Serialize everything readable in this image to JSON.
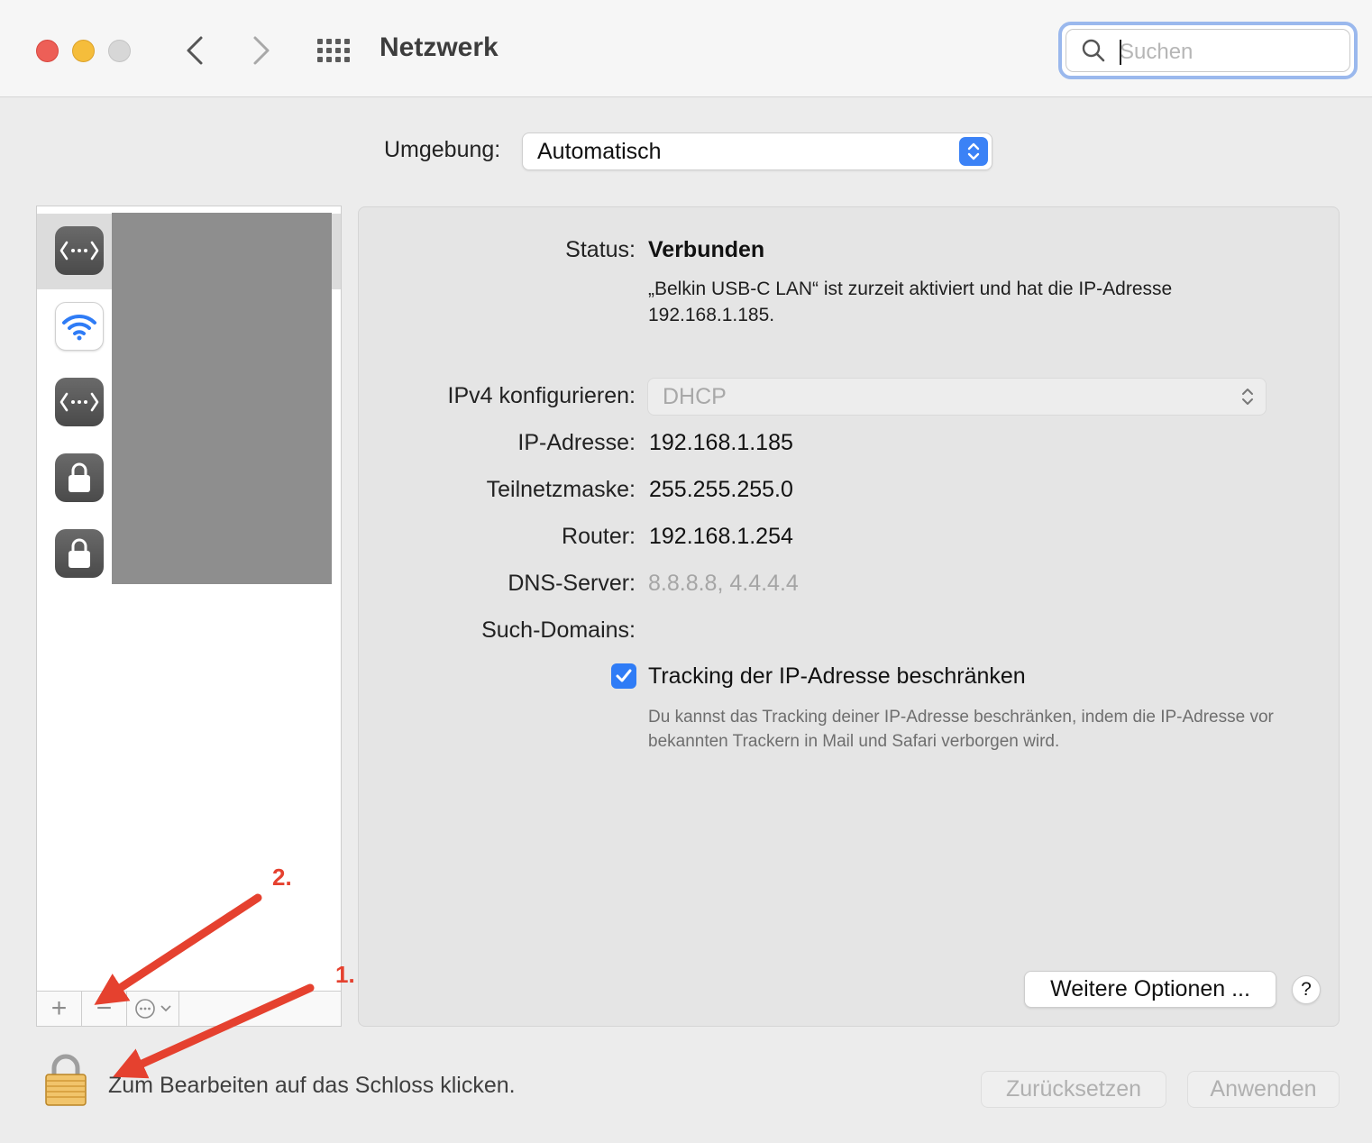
{
  "window": {
    "title": "Netzwerk"
  },
  "search": {
    "placeholder": "Suchen"
  },
  "environment": {
    "label": "Umgebung:",
    "value": "Automatisch"
  },
  "sidebar": {
    "services": [
      {
        "icon": "ethernet-icon"
      },
      {
        "icon": "wifi-icon"
      },
      {
        "icon": "ethernet-icon"
      },
      {
        "icon": "lock-icon"
      },
      {
        "icon": "lock-icon"
      }
    ],
    "toolbar": {
      "add": "+",
      "remove": "−"
    }
  },
  "details": {
    "status_label": "Status:",
    "status_value": "Verbunden",
    "status_description": "„Belkin USB-C LAN“ ist zurzeit aktiviert und hat die IP-Adresse 192.168.1.185.",
    "ipv4_label": "IPv4 konfigurieren:",
    "ipv4_value": "DHCP",
    "ip_label": "IP-Adresse:",
    "ip_value": "192.168.1.185",
    "subnet_label": "Teilnetzmaske:",
    "subnet_value": "255.255.255.0",
    "router_label": "Router:",
    "router_value": "192.168.1.254",
    "dns_label": "DNS-Server:",
    "dns_value": "8.8.8.8, 4.4.4.4",
    "search_domains_label": "Such-Domains:",
    "tracking_checkbox_label": "Tracking der IP-Adresse beschränken",
    "tracking_checked": true,
    "tracking_description": "Du kannst das Tracking deiner IP-Adresse beschränken, indem die IP-Adresse vor bekannten Trackern in Mail und Safari verborgen wird.",
    "more_options": "Weitere Optionen ...",
    "help": "?"
  },
  "footer": {
    "lock_text": "Zum Bearbeiten auf das Schloss klicken.",
    "reset": "Zurücksetzen",
    "apply": "Anwenden"
  },
  "annotations": {
    "step1": "1.",
    "step2": "2."
  },
  "colors": {
    "accent": "#2f7cf6",
    "annotation": "#e5412f"
  }
}
